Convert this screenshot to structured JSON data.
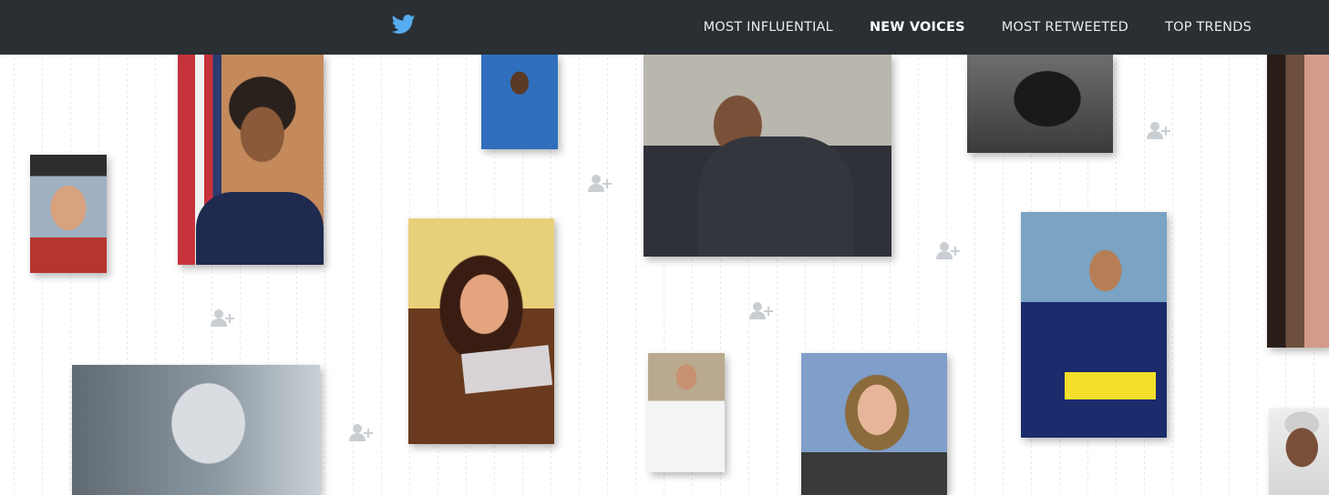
{
  "header": {
    "logo_icon": "twitter-bird-icon",
    "nav": [
      {
        "label": "MOST INFLUENTIAL",
        "active": false
      },
      {
        "label": "NEW VOICES",
        "active": true
      },
      {
        "label": "MOST RETWEETED",
        "active": false
      },
      {
        "label": "TOP TRENDS",
        "active": false
      }
    ]
  },
  "colors": {
    "topbar": "#292f33",
    "nav_text": "#e6ecf0",
    "bird": "#55acee",
    "follow_icon": "#c9ced3",
    "background": "#ffffff"
  },
  "grid": {
    "photos": [
      {
        "name": "person-photo-1"
      },
      {
        "name": "person-photo-2"
      },
      {
        "name": "person-photo-3"
      },
      {
        "name": "person-photo-4"
      },
      {
        "name": "person-photo-5"
      },
      {
        "name": "person-photo-6"
      },
      {
        "name": "person-photo-7"
      },
      {
        "name": "person-photo-8"
      },
      {
        "name": "person-photo-9"
      },
      {
        "name": "person-photo-10"
      },
      {
        "name": "person-photo-11"
      },
      {
        "name": "person-photo-12"
      }
    ],
    "follow_icons": [
      {
        "icon": "follow-user-icon"
      },
      {
        "icon": "follow-user-icon"
      },
      {
        "icon": "follow-user-icon"
      },
      {
        "icon": "follow-user-icon"
      },
      {
        "icon": "follow-user-icon"
      },
      {
        "icon": "follow-user-icon"
      }
    ]
  }
}
